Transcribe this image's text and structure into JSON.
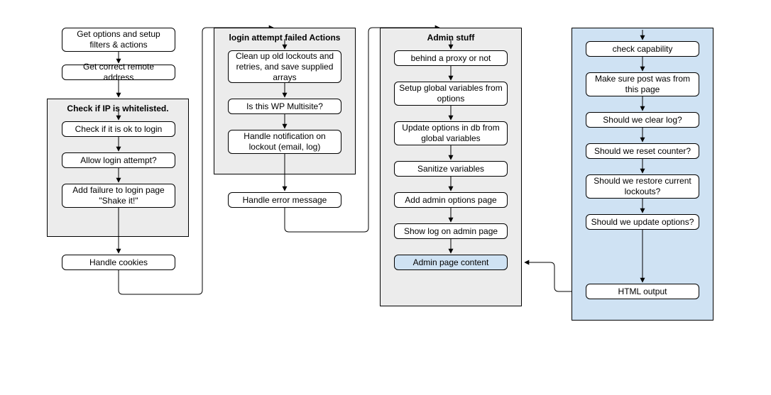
{
  "chart_data": {
    "type": "flowchart",
    "columns": [
      {
        "group": null,
        "nodes": [
          "Get options and setup filters & actions",
          "Get correct remote address"
        ]
      },
      {
        "group": "Check if IP is whitelisted.",
        "nodes": [
          "Check if it is ok to login",
          "Allow login attempt?",
          "Add failure to login page \"Shake it!\""
        ]
      },
      {
        "group": null,
        "nodes": [
          "Handle cookies"
        ]
      },
      {
        "group": "login attempt failed Actions",
        "nodes": [
          "Clean up old lockouts and retries, and save supplied arrays",
          "Is this WP Multisite?",
          "Handle notification on lockout (email, log)"
        ]
      },
      {
        "group": null,
        "nodes": [
          "Handle error message"
        ]
      },
      {
        "group": "Admin stuff",
        "nodes": [
          "behind a proxy or not",
          "Setup global variables from options",
          "Update options in db from global variables",
          "Sanitize variables",
          "Add admin options page",
          "Show log on admin page",
          "Admin page content"
        ]
      },
      {
        "group": null,
        "group_color": "blue",
        "nodes": [
          "check capability",
          "Make sure post was from this page",
          "Should we clear log?",
          "Should we reset counter?",
          "Should we restore current lockouts?",
          "Should we update options?",
          "HTML output"
        ]
      }
    ],
    "notes": "Vertical arrows connect consecutive nodes within each column. Rounded connectors link column 1→2, 2→3, 3→4. A double-headed arrow links 'Admin page content' and 'HTML output'."
  },
  "c1": {
    "n1": "Get options and setup filters & actions",
    "n2": "Get correct remote address"
  },
  "g1": {
    "title": "Check if IP is whitelisted."
  },
  "c1b": {
    "n1": "Check if it is ok to login",
    "n2": "Allow login attempt?",
    "n3": "Add failure to login page \"Shake it!\""
  },
  "c1c": {
    "n1": "Handle cookies"
  },
  "g2": {
    "title": "login attempt failed Actions"
  },
  "c2": {
    "n1": "Clean up old lockouts and retries, and save supplied arrays",
    "n2": "Is this WP Multisite?",
    "n3": "Handle notification on lockout (email, log)"
  },
  "c2b": {
    "n1": "Handle error message"
  },
  "g3": {
    "title": "Admin stuff"
  },
  "c3": {
    "n1": "behind a proxy or not",
    "n2": "Setup global variables from options",
    "n3": "Update options in db from global variables",
    "n4": "Sanitize variables",
    "n5": "Add admin options page",
    "n6": "Show log on admin page",
    "n7": "Admin page content"
  },
  "c4": {
    "n1": "check capability",
    "n2": "Make sure post was from this page",
    "n3": "Should we clear log?",
    "n4": "Should we reset counter?",
    "n5": "Should we restore current lockouts?",
    "n6": "Should we update options?",
    "n7": "HTML output"
  }
}
